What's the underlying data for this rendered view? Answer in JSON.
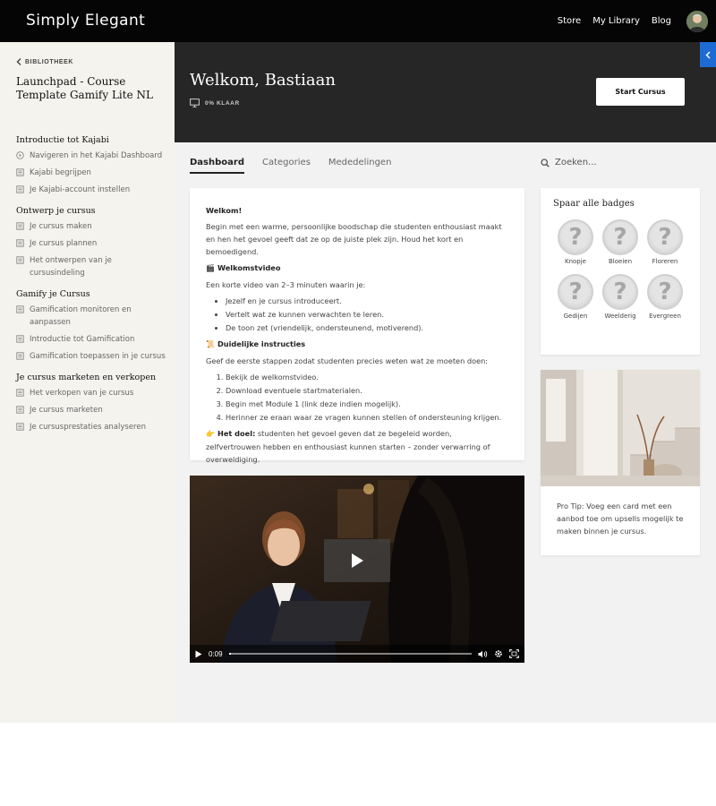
{
  "header": {
    "brand": "Simply Elegant",
    "nav": [
      "Store",
      "My Library",
      "Blog"
    ]
  },
  "sidebar": {
    "back_label": "BIBLIOTHEEK",
    "course_title": "Launchpad - Course Template Gamify Lite NL",
    "modules": [
      {
        "title": "Introductie tot Kajabi",
        "lessons": [
          "Navigeren in het Kajabi Dashboard",
          "Kajabi begrijpen",
          "Je Kajabi-account instellen"
        ]
      },
      {
        "title": "Ontwerp je cursus",
        "lessons": [
          "Je cursus maken",
          "Je cursus plannen",
          "Het ontwerpen van je cursusindeling"
        ]
      },
      {
        "title": "Gamify je Cursus",
        "lessons": [
          "Gamification monitoren en aanpassen",
          "Introductie tot Gamification",
          "Gamification toepassen in je cursus"
        ]
      },
      {
        "title": "Je cursus marketen en verkopen",
        "lessons": [
          "Het verkopen van je cursus",
          "Je cursus marketen",
          "Je cursusprestaties analyseren"
        ]
      }
    ]
  },
  "hero": {
    "welcome": "Welkom, Bastiaan",
    "progress_label": "0% KLAAR",
    "progress_value": 0,
    "start_button": "Start Cursus"
  },
  "tabs": [
    {
      "label": "Dashboard",
      "active": true
    },
    {
      "label": "Categories",
      "active": false
    },
    {
      "label": "Mededelingen",
      "active": false
    }
  ],
  "search": {
    "placeholder": "Zoeken..."
  },
  "welcome_card": {
    "greeting": "Welkom!",
    "intro": "Begin met een warme, persoonlijke boodschap die studenten enthousiast maakt en hen het gevoel geeft dat ze op de juiste plek zijn. Houd het kort en bemoedigend.",
    "video_heading": "Welkomstvideo",
    "video_intro": "Een korte video van 2–3 minuten waarin je:",
    "video_points": [
      "Jezelf en je cursus introduceert.",
      "Vertelt wat ze kunnen verwachten te leren.",
      "De toon zet (vriendelijk, ondersteunend, motiverend)."
    ],
    "instructions_heading": "Duidelijke instructies",
    "instructions_intro": "Geef de eerste stappen zodat studenten precies weten wat ze moeten doen:",
    "instructions_steps": [
      "Bekijk de welkomstvideo.",
      "Download eventuele startmaterialen.",
      "Begin met Module 1 (link deze indien mogelijk).",
      "Herinner ze eraan waar ze vragen kunnen stellen of ondersteuning krijgen."
    ],
    "goal_heading": "Het doel:",
    "goal_text": "studenten het gevoel geven dat ze begeleid worden, zelfvertrouwen hebben en enthousiast kunnen starten – zonder verwarring of overweldiging."
  },
  "video": {
    "time": "0:09",
    "progress": 0.01
  },
  "badges": {
    "title": "Spaar alle badges",
    "items": [
      "Knopje",
      "Bloeien",
      "Floreren",
      "Gedijen",
      "Weelderig",
      "Evergreen"
    ]
  },
  "tip": {
    "text": "Pro Tip: Voeg een card met een aanbod toe om upsells mogelijk te maken binnen je cursus."
  },
  "colors": {
    "topbar": "#050505",
    "hero": "#262626",
    "sidebar": "#f4f3ee",
    "accent_toggle": "#1f6bd6"
  }
}
